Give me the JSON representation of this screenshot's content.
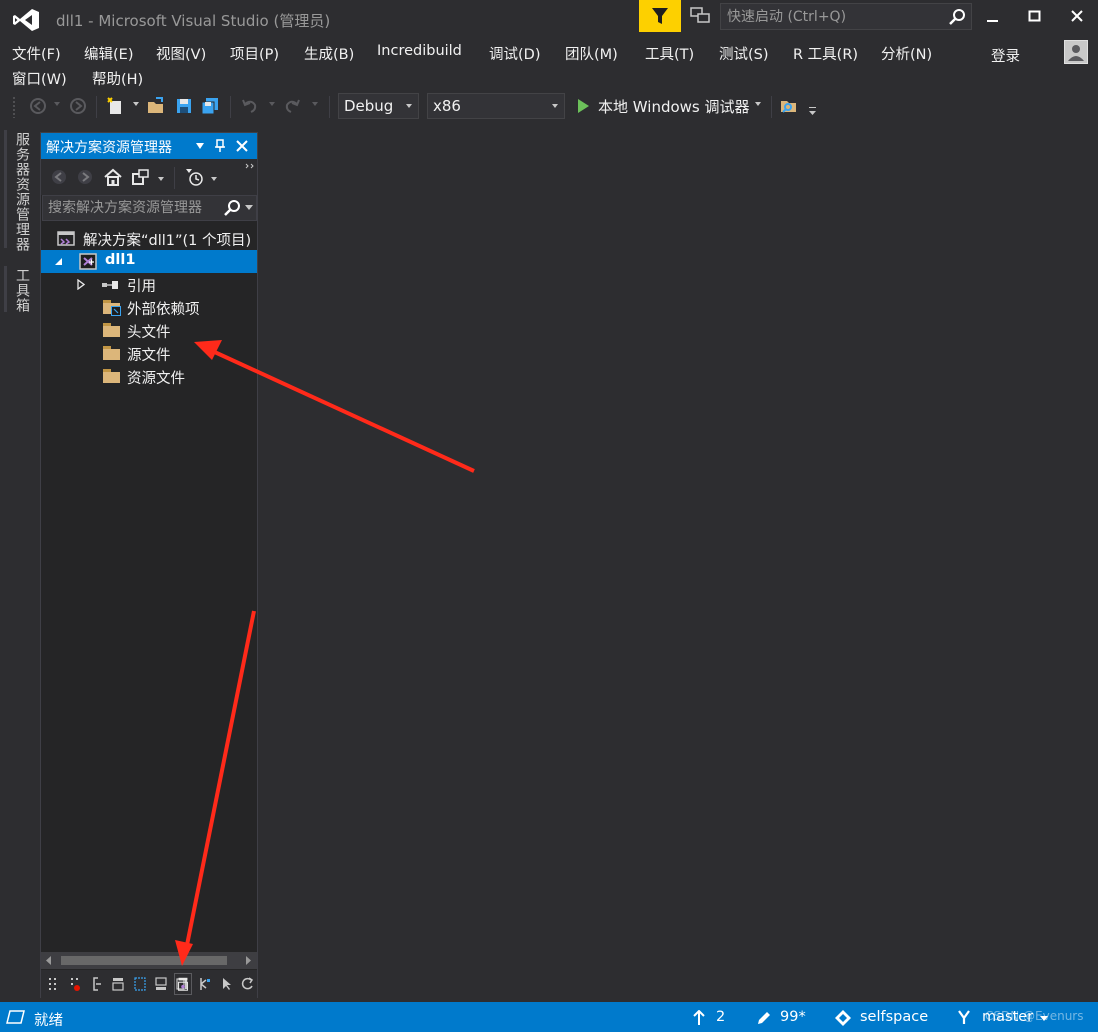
{
  "window": {
    "title": "dll1 - Microsoft Visual Studio (管理员)",
    "quick_launch_placeholder": "快速启动 (Ctrl+Q)"
  },
  "menu": {
    "row1": [
      "文件(F)",
      "编辑(E)",
      "视图(V)",
      "项目(P)",
      "生成(B)",
      "Incredibuild",
      "调试(D)",
      "团队(M)",
      "工具(T)",
      "测试(S)",
      "R 工具(R)",
      "分析(N)"
    ],
    "row2": [
      "窗口(W)",
      "帮助(H)"
    ],
    "login": "登录"
  },
  "toolbar": {
    "configuration": "Debug",
    "platform": "x86",
    "run_label": "本地 Windows 调试器"
  },
  "side_tabs": [
    "服务器资源管理器",
    "工具箱"
  ],
  "solution_explorer": {
    "title": "解决方案资源管理器",
    "search_placeholder": "搜索解决方案资源管理器",
    "tree": [
      {
        "label": "解决方案“dll1”(1 个项目)",
        "kind": "solution"
      },
      {
        "label": "dll1",
        "kind": "project",
        "selected": true
      },
      {
        "label": "引用",
        "kind": "references"
      },
      {
        "label": "外部依赖项",
        "kind": "external-deps"
      },
      {
        "label": "头文件",
        "kind": "folder"
      },
      {
        "label": "源文件",
        "kind": "folder"
      },
      {
        "label": "资源文件",
        "kind": "folder"
      }
    ]
  },
  "statusbar": {
    "status": "就绪",
    "commits_ahead": "2",
    "changes": "99*",
    "repository": "selfspace",
    "branch": "master"
  },
  "watermark": "CSDN @Evenurs",
  "colors": {
    "accent": "#007acc",
    "background": "#2d2d30",
    "panel": "#252526",
    "filter_highlight": "#fdd000",
    "annotation_arrow": "#ff2a1a"
  }
}
